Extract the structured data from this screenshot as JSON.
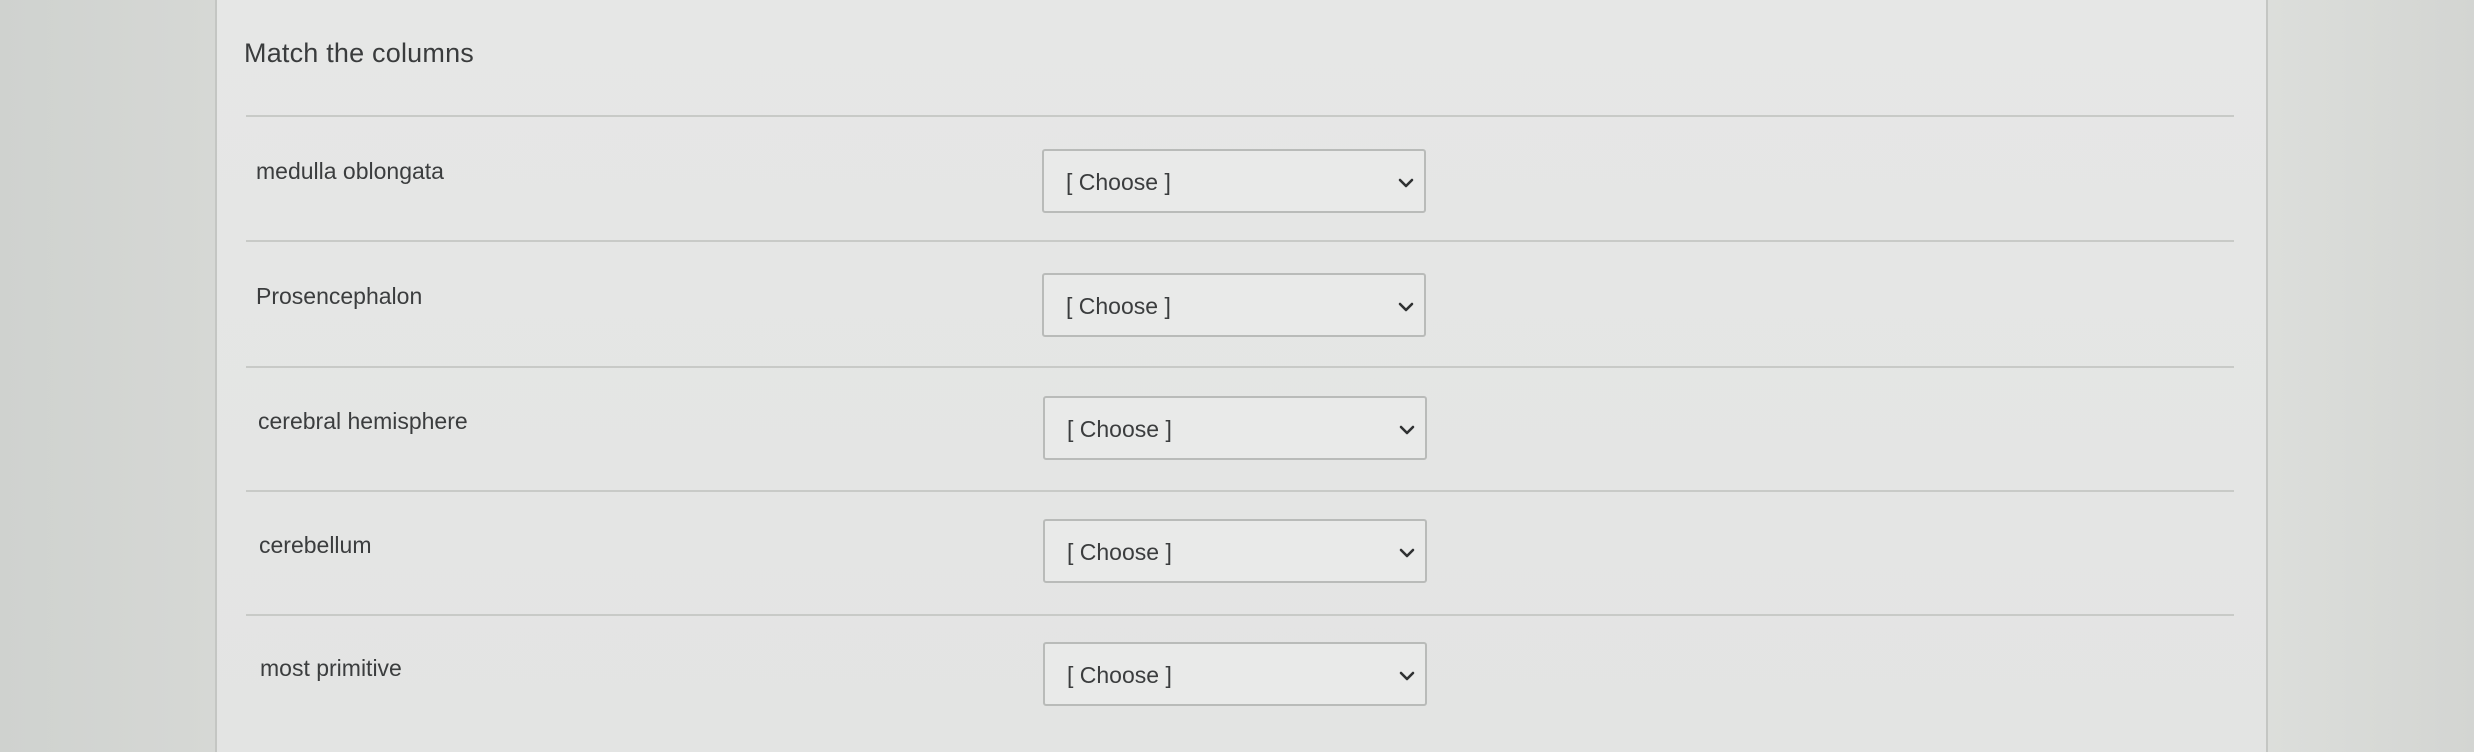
{
  "quiz": {
    "title": "Match the columns",
    "rows": [
      {
        "label": "medulla oblongata",
        "selected": "[ Choose ]"
      },
      {
        "label": "Prosencephalon",
        "selected": "[ Choose ]"
      },
      {
        "label": "cerebral hemisphere",
        "selected": "[ Choose ]"
      },
      {
        "label": "cerebellum",
        "selected": "[ Choose ]"
      },
      {
        "label": "most primitive",
        "selected": "[ Choose ]"
      }
    ]
  },
  "icons": {
    "select_arrow": "chevron-down-icon"
  }
}
